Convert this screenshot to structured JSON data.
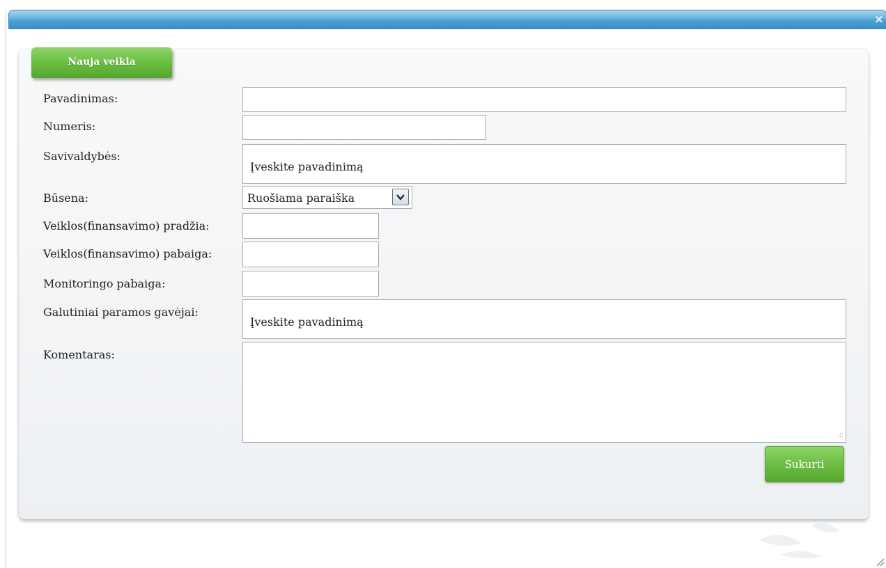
{
  "dialog": {
    "close_symbol": "×"
  },
  "tab": {
    "title": "Nauja veikla"
  },
  "form": {
    "labels": {
      "pavadinimas": "Pavadinimas:",
      "numeris": "Numeris:",
      "savivaldybes": "Savivaldybės:",
      "busena": "Būsena:",
      "pradzia": "Veiklos(finansavimo) pradžia:",
      "pabaiga": "Veiklos(finansavimo) pabaiga:",
      "monitoringo_pabaiga": "Monitoringo pabaiga:",
      "gavejai": "Galutiniai paramos gavėjai:",
      "komentaras": "Komentaras:"
    },
    "values": {
      "pavadinimas": "",
      "numeris": "",
      "pradzia": "",
      "pabaiga": "",
      "monitoringo_pabaiga": "",
      "komentaras": ""
    },
    "savivaldybes_prompt": "Įveskite pavadinimą",
    "gavejai_prompt": "Įveskite pavadinimą",
    "busena_selected": "Ruošiama paraiška",
    "submit_label": "Sukurti"
  },
  "icons": {
    "close": "close-icon",
    "dropdown": "chevron-down-icon",
    "resize": "resize-grip-icon"
  },
  "colors": {
    "titlebar": "#4a9ed2",
    "accent_green": "#6dbd45"
  }
}
